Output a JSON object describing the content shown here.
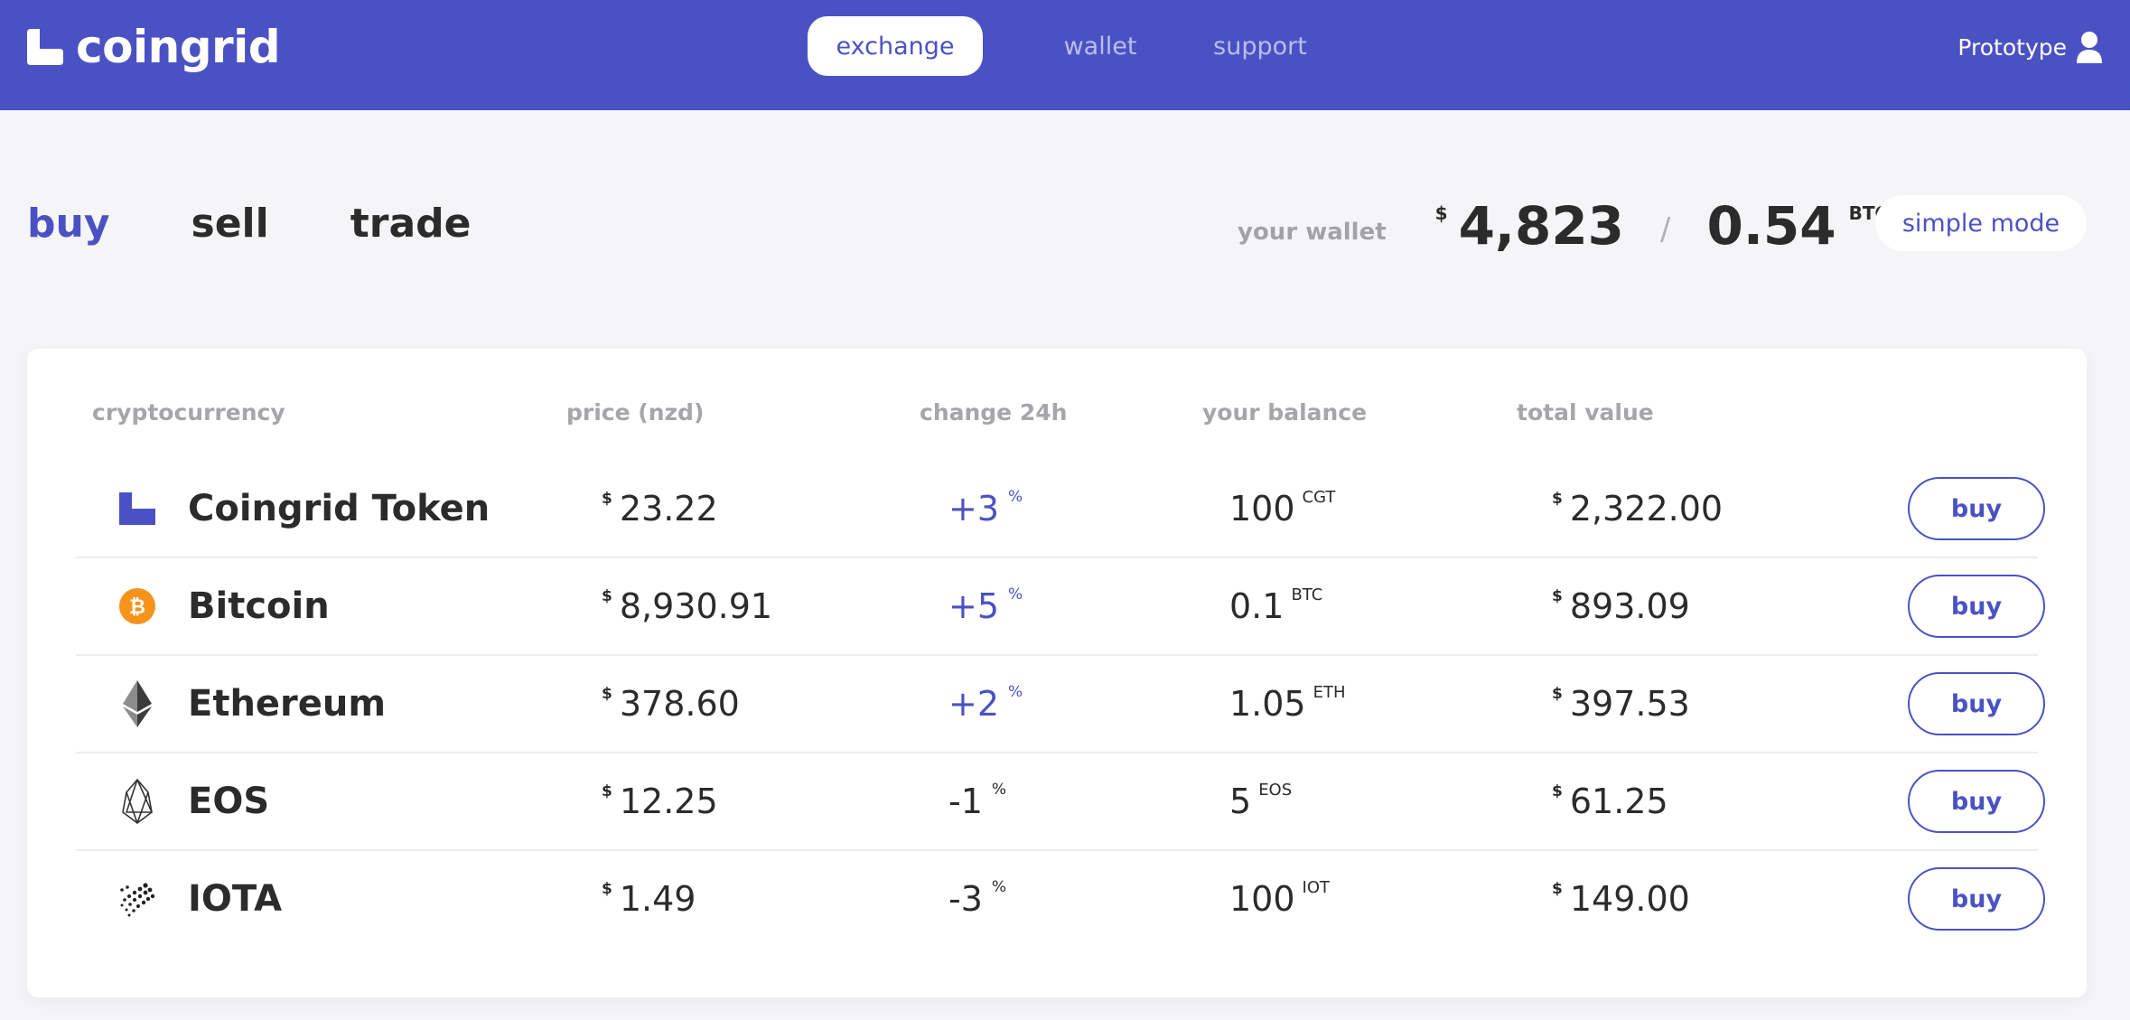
{
  "brand": {
    "name": "coingrid",
    "accent": "#4a52c3"
  },
  "nav": {
    "tabs": [
      {
        "label": "exchange",
        "active": true
      },
      {
        "label": "wallet",
        "active": false
      },
      {
        "label": "support",
        "active": false
      }
    ],
    "user_label": "Prototype"
  },
  "mode_tabs": [
    {
      "label": "buy",
      "active": true
    },
    {
      "label": "sell",
      "active": false
    },
    {
      "label": "trade",
      "active": false
    }
  ],
  "wallet": {
    "label": "your wallet",
    "currency_symbol": "$",
    "fiat_value": "4,823",
    "separator": "/",
    "btc_value": "0.54",
    "btc_unit": "BTC"
  },
  "simple_mode_label": "simple mode",
  "table": {
    "columns": [
      "cryptocurrency",
      "price (nzd)",
      "change 24h",
      "your balance",
      "total value"
    ],
    "rows": [
      {
        "icon": "coingrid-token-icon",
        "name": "Coingrid Token",
        "price": "23.22",
        "change": "+3",
        "change_dir": "pos",
        "balance": "100",
        "balance_unit": "CGT",
        "total": "2,322.00",
        "action": "buy"
      },
      {
        "icon": "bitcoin-icon",
        "name": "Bitcoin",
        "price": "8,930.91",
        "change": "+5",
        "change_dir": "pos",
        "balance": "0.1",
        "balance_unit": "BTC",
        "total": "893.09",
        "action": "buy"
      },
      {
        "icon": "ethereum-icon",
        "name": "Ethereum",
        "price": "378.60",
        "change": "+2",
        "change_dir": "pos",
        "balance": "1.05",
        "balance_unit": "ETH",
        "total": "397.53",
        "action": "buy"
      },
      {
        "icon": "eos-icon",
        "name": "EOS",
        "price": "12.25",
        "change": "-1",
        "change_dir": "neg",
        "balance": "5",
        "balance_unit": "EOS",
        "total": "61.25",
        "action": "buy"
      },
      {
        "icon": "iota-icon",
        "name": "IOTA",
        "price": "1.49",
        "change": "-3",
        "change_dir": "neg",
        "balance": "100",
        "balance_unit": "IOT",
        "total": "149.00",
        "action": "buy"
      }
    ],
    "currency_symbol": "$",
    "percent_symbol": "%"
  }
}
